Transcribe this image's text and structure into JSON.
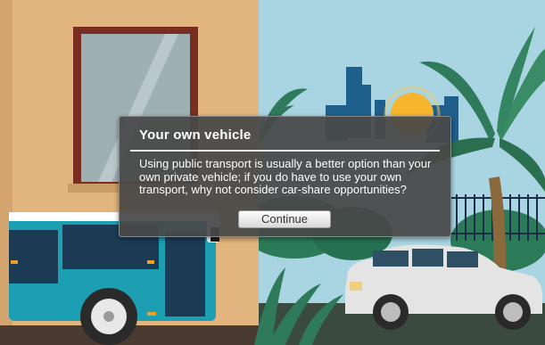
{
  "dialog": {
    "title": "Your own vehicle",
    "body": "Using public transport is usually a better option than your own private vehicle; if you do have to use your own transport, why not consider car-share opportunities?",
    "continue_label": "Continue"
  },
  "colors": {
    "wall": "#e2b57e",
    "sky": "#a9d5e2",
    "bus": "#1c9fb3",
    "car": "#e4e4e4",
    "dialog_bg": "#484848",
    "sun": "#f5b52f",
    "palm": "#2f7a5a"
  }
}
